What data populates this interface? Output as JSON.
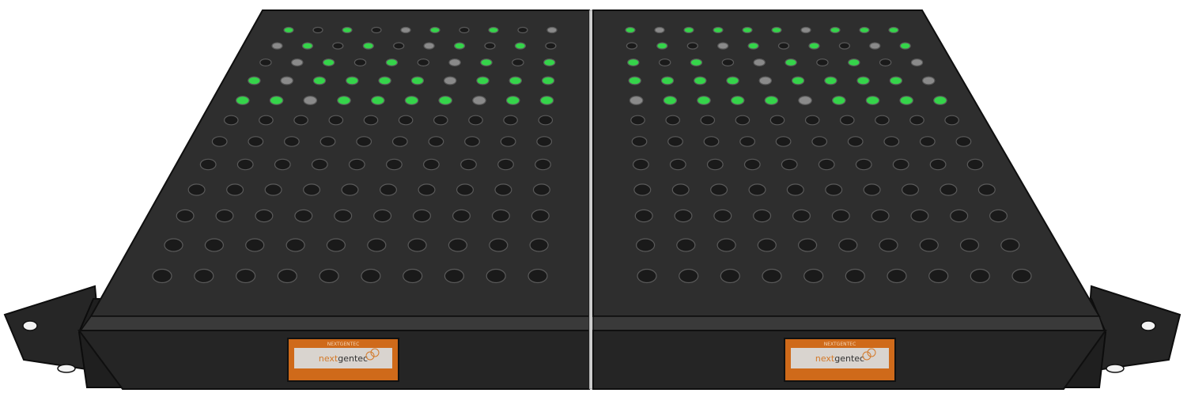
{
  "scene": {
    "subject": "rack-mount-dual-enclosure",
    "colors": {
      "background": "#ffffff",
      "chassis_top": "#2e2e2e",
      "chassis_front": "#262626",
      "chassis_edge": "#111111",
      "hole": "#1a1a1a",
      "hole_rim": "#5a5a5a",
      "led_green": "#35d44a",
      "led_grey": "#8a8a8a",
      "label_orange": "#cf6a1a",
      "label_light": "#d9d4cf"
    }
  },
  "units": [
    {
      "id": "left",
      "label": {
        "top_text": "NEXTGENTEC",
        "brand_prefix": "next",
        "brand_suffix": "gentec"
      }
    },
    {
      "id": "right",
      "label": {
        "top_text": "NEXTGENTEC",
        "brand_prefix": "next",
        "brand_suffix": "gentec"
      }
    }
  ]
}
